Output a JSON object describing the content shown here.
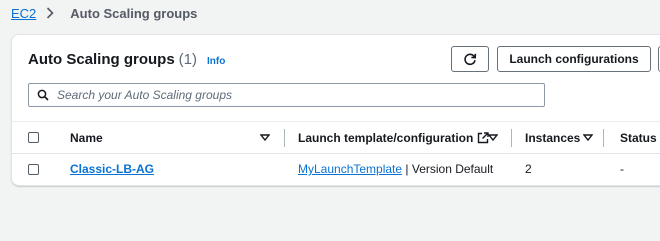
{
  "breadcrumb": {
    "root": "EC2",
    "current": "Auto Scaling groups"
  },
  "header": {
    "title": "Auto Scaling groups",
    "count": "(1)",
    "info": "Info"
  },
  "buttons": {
    "launch_configurations": "Launch configurations"
  },
  "search": {
    "placeholder": "Search your Auto Scaling groups"
  },
  "table": {
    "columns": {
      "name": "Name",
      "launch_template": "Launch template/configuration",
      "instances": "Instances",
      "status": "Status"
    },
    "rows": [
      {
        "name": "Classic-LB-AG",
        "launch_template": "MyLaunchTemplate",
        "version": " | Version Default",
        "instances": "2",
        "status": "-"
      }
    ]
  },
  "colors": {
    "link": "#0972d3",
    "background": "#f2f3f3"
  }
}
